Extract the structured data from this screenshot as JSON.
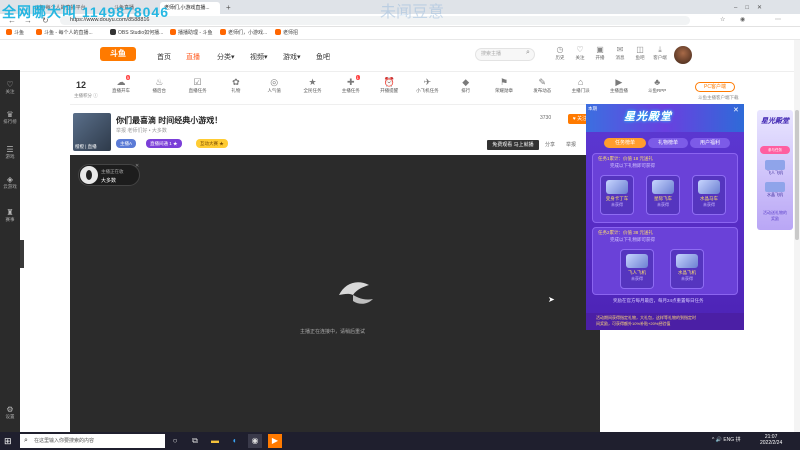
{
  "browser": {
    "tabs": [
      {
        "label": "斗鱼-每个人的直播平台"
      },
      {
        "label": "斗鱼直播"
      },
      {
        "label": "老师们,小游戏直播..."
      }
    ],
    "url": "https://www.douyu.com/8588816",
    "bookmarks": [
      "斗鱼",
      "斗鱼 - 每个人的直播...",
      "OBS Studio如何播...",
      "播播助理 - 斗鱼",
      "老师们，小游戏...",
      "老师招"
    ]
  },
  "overlay": {
    "watermark": "全网哪大叫 1149878046",
    "watermark2": "未闻豆意"
  },
  "sidebar": {
    "items": [
      {
        "icon": "heart-icon",
        "label": "关注"
      },
      {
        "icon": "trophy-icon",
        "label": "排行榜"
      },
      {
        "icon": "list-icon",
        "label": "游戏"
      },
      {
        "icon": "gamepad-icon",
        "label": "云游戏"
      },
      {
        "icon": "cup-icon",
        "label": "赛事"
      },
      {
        "icon": "gear-icon",
        "label": "设置"
      }
    ]
  },
  "header": {
    "logo_text": "斗鱼",
    "nav": [
      {
        "label": "首页"
      },
      {
        "label": "直播"
      },
      {
        "label": "分类▾"
      },
      {
        "label": "视频▾"
      },
      {
        "label": "游戏▾"
      },
      {
        "label": "鱼吧"
      }
    ],
    "search_placeholder": "搜索主播",
    "icons": [
      {
        "label": "历史"
      },
      {
        "label": "关注"
      },
      {
        "label": "开播"
      },
      {
        "label": "消息"
      },
      {
        "label": "鱼吧"
      },
      {
        "label": "客户端"
      }
    ]
  },
  "toolbar": {
    "level": "12",
    "level_label": "主播积分 ⓘ",
    "items": [
      {
        "label": "直播开车",
        "badge": "5"
      },
      {
        "label": "播后台"
      },
      {
        "label": "直播任务"
      },
      {
        "label": "礼物"
      },
      {
        "label": "人气值"
      },
      {
        "label": "全民任务"
      },
      {
        "label": "主播任务",
        "badge": "1"
      },
      {
        "label": "开播提醒"
      },
      {
        "label": "小飞机任务"
      },
      {
        "label": "排行"
      },
      {
        "label": "荣耀勋章"
      },
      {
        "label": "发布动态"
      },
      {
        "label": "主播门派"
      },
      {
        "label": "主播直播"
      },
      {
        "label": "斗鱼RPP"
      }
    ],
    "pc_button": "PC客户端",
    "pc_sub": "斗鱼主播客户端下载"
  },
  "room": {
    "thumb_caption": "橙橙 | 直播",
    "title": "你们最喜滴 时间经典小游戏！",
    "meta": "举报   老师们好 • 大多数",
    "tags": [
      {
        "label": "主播A",
        "bg": "#5b7bd6"
      },
      {
        "label": "直播间通 1 ★",
        "bg": "#7b3fd8"
      },
      {
        "label": "互动大赛 ★",
        "bg": "#ffcc33"
      }
    ],
    "rightmeta": "3730",
    "follow": "♥ 关注",
    "invite": "免费观看 马上就播",
    "share": "分享",
    "report": "举报"
  },
  "player": {
    "anchor_sub": "主播正在收",
    "anchor_name": "大多数",
    "offline_text": "主播正在连接中，请稍后重试"
  },
  "event": {
    "title": "星光殿堂",
    "corner": "本期",
    "tabs": [
      {
        "label": "任务榜单"
      },
      {
        "label": "礼物榜单"
      },
      {
        "label": "用户福利"
      }
    ],
    "task1": "任务1累计：价值 18 元送礼",
    "task1_sub": "完成以下礼物即可获得",
    "items1": [
      {
        "name": "变身卡丁车",
        "state": "未获得"
      },
      {
        "name": "星际飞车",
        "state": "未获得"
      },
      {
        "name": "水晶马车",
        "state": "未获得"
      }
    ],
    "task2": "任务2累计：价值 38 元送礼",
    "task2_sub": "完成以下礼物即可获得",
    "items2": [
      {
        "name": "飞人飞机",
        "state": "未获得"
      },
      {
        "name": "水晶飞机",
        "state": "未获得"
      }
    ],
    "footnote": "奖励在官方每月最后，每月24点重置每日任务",
    "bottom_line1": "活动期间获得指定礼物，大礼包，这样等礼物的到指定时",
    "bottom_line2": "间奖励，可获得额外10%补贴+20%经验值"
  },
  "minibanner": {
    "title": "星光殿堂",
    "button": "参与任务",
    "items": [
      "飞人飞机",
      "水晶飞机"
    ],
    "foot": "活动送礼物的奖励"
  },
  "taskbar": {
    "search_placeholder": "在这里输入你要搜索的内容",
    "tray": "^ 🔊 ENG 拼",
    "time": "21:07",
    "date": "2022/2/24"
  },
  "colors": {
    "accent": "#ff7a00",
    "live_nav": "#ff5d23",
    "event_purple": "#5a2fc9",
    "player_bg": "#2b2b2b"
  }
}
